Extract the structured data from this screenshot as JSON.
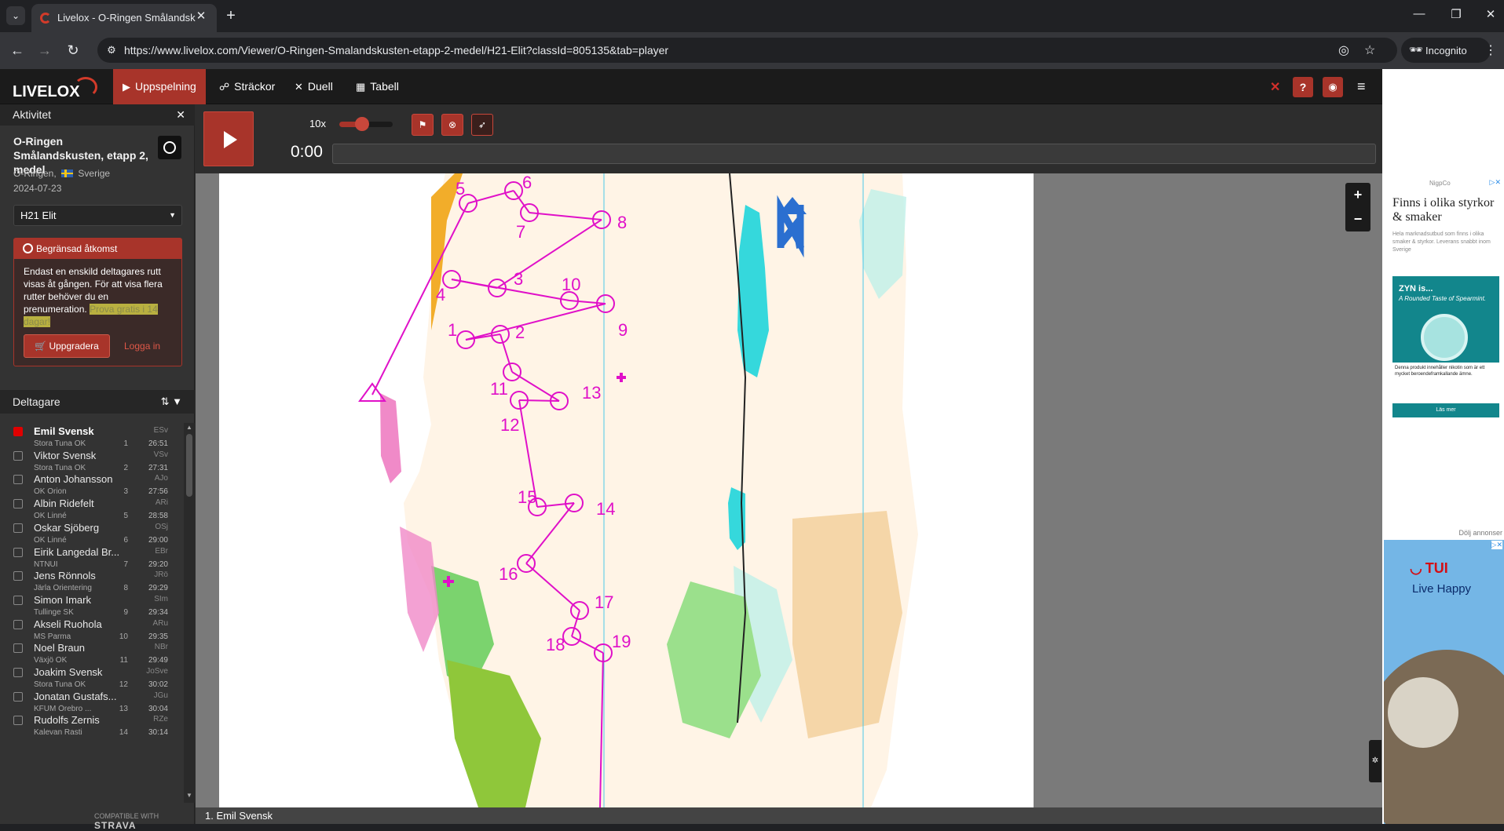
{
  "browser": {
    "tab_title": "Livelox - O-Ringen Smålandskusten",
    "url": "https://www.livelox.com/Viewer/O-Ringen-Smalandskusten-etapp-2-medel/H21-Elit?classId=805135&tab=player",
    "incognito_label": "Incognito"
  },
  "app": {
    "logo": "LIVELOX",
    "nav": [
      {
        "label": "Uppspelning",
        "icon": "play-icon"
      },
      {
        "label": "Sträckor",
        "icon": "route-icon"
      },
      {
        "label": "Duell",
        "icon": "swords-icon"
      },
      {
        "label": "Tabell",
        "icon": "table-icon"
      }
    ]
  },
  "activity": {
    "panel_title": "Aktivitet",
    "event_title": "O-Ringen Smålandskusten, etapp 2, medel",
    "organizer": "O-Ringen,",
    "country": "Sverige",
    "date": "2024-07-23",
    "class_selected": "H21 Elit"
  },
  "restricted": {
    "title": "Begränsad åtkomst",
    "text": "Endast en enskild deltagares rutt visas åt gången. För att visa flera rutter behöver du en prenumeration.",
    "highlight": "Prova gratis i 14 dagar!",
    "upgrade_label": "Uppgradera",
    "login_label": "Logga in"
  },
  "participants": {
    "title": "Deltagare",
    "rows": [
      {
        "name": "Emil Svensk",
        "club": "Stora Tuna OK",
        "rank": "1",
        "time": "26:51",
        "abbr": "ESv",
        "selected": true
      },
      {
        "name": "Viktor Svensk",
        "club": "Stora Tuna OK",
        "rank": "2",
        "time": "27:31",
        "abbr": "VSv",
        "selected": false
      },
      {
        "name": "Anton Johansson",
        "club": "OK Orion",
        "rank": "3",
        "time": "27:56",
        "abbr": "AJo",
        "selected": false
      },
      {
        "name": "Albin Ridefelt",
        "club": "OK Linné",
        "rank": "5",
        "time": "28:58",
        "abbr": "ARi",
        "selected": false
      },
      {
        "name": "Oskar Sjöberg",
        "club": "OK Linné",
        "rank": "6",
        "time": "29:00",
        "abbr": "OSj",
        "selected": false
      },
      {
        "name": "Eirik Langedal Br...",
        "club": "NTNUI",
        "rank": "7",
        "time": "29:20",
        "abbr": "EBr",
        "selected": false
      },
      {
        "name": "Jens Rönnols",
        "club": "Järla Orientering",
        "rank": "8",
        "time": "29:29",
        "abbr": "JRö",
        "selected": false
      },
      {
        "name": "Simon Imark",
        "club": "Tullinge SK",
        "rank": "9",
        "time": "29:34",
        "abbr": "SIm",
        "selected": false
      },
      {
        "name": "Akseli Ruohola",
        "club": "MS Parma",
        "rank": "10",
        "time": "29:35",
        "abbr": "ARu",
        "selected": false
      },
      {
        "name": "Noel Braun",
        "club": "Växjö OK",
        "rank": "11",
        "time": "29:49",
        "abbr": "NBr",
        "selected": false
      },
      {
        "name": "Joakim Svensk",
        "club": "Stora Tuna OK",
        "rank": "12",
        "time": "30:02",
        "abbr": "JoSve",
        "selected": false
      },
      {
        "name": "Jonatan Gustafs...",
        "club": "KFUM Örebro ...",
        "rank": "13",
        "time": "30:04",
        "abbr": "JGu",
        "selected": false
      },
      {
        "name": "Rudolfs Zernis",
        "club": "Kalevan Rasti",
        "rank": "14",
        "time": "30:14",
        "abbr": "RZe",
        "selected": false
      }
    ],
    "strava_prefix": "COMPATIBLE WITH",
    "strava": "STRAVA"
  },
  "player": {
    "speed": "10x",
    "clock": "0:00"
  },
  "map": {
    "current_runner": "1. Emil Svensk",
    "controls": [
      {
        "n": "5"
      },
      {
        "n": "6"
      },
      {
        "n": "7"
      },
      {
        "n": "8"
      },
      {
        "n": "3"
      },
      {
        "n": "4"
      },
      {
        "n": "10"
      },
      {
        "n": "9"
      },
      {
        "n": "1"
      },
      {
        "n": "2"
      },
      {
        "n": "11"
      },
      {
        "n": "13"
      },
      {
        "n": "12"
      },
      {
        "n": "15"
      },
      {
        "n": "14"
      },
      {
        "n": "16"
      },
      {
        "n": "17"
      },
      {
        "n": "18"
      },
      {
        "n": "19"
      }
    ]
  },
  "ads": {
    "ad1_source": "NigpCo",
    "ad1_heading": "Finns i olika styrkor & smaker",
    "ad1_text": "Hela marknadsutbud som finns i olika smaker & styrkor. Leverans snabbt inom Sverige",
    "ad1_brand": "ZYN is...",
    "ad1_slogan": "A Rounded Taste of Spearmint.",
    "ad1_warning": "Denna produkt innehåller nikotin som är ett mycket beroendeframkallande ämne.",
    "ad1_button": "Läs mer",
    "hide_ads": "Dölj annonser",
    "ad2_brand": "TUI",
    "ad2_tagline": "Live Happy"
  }
}
